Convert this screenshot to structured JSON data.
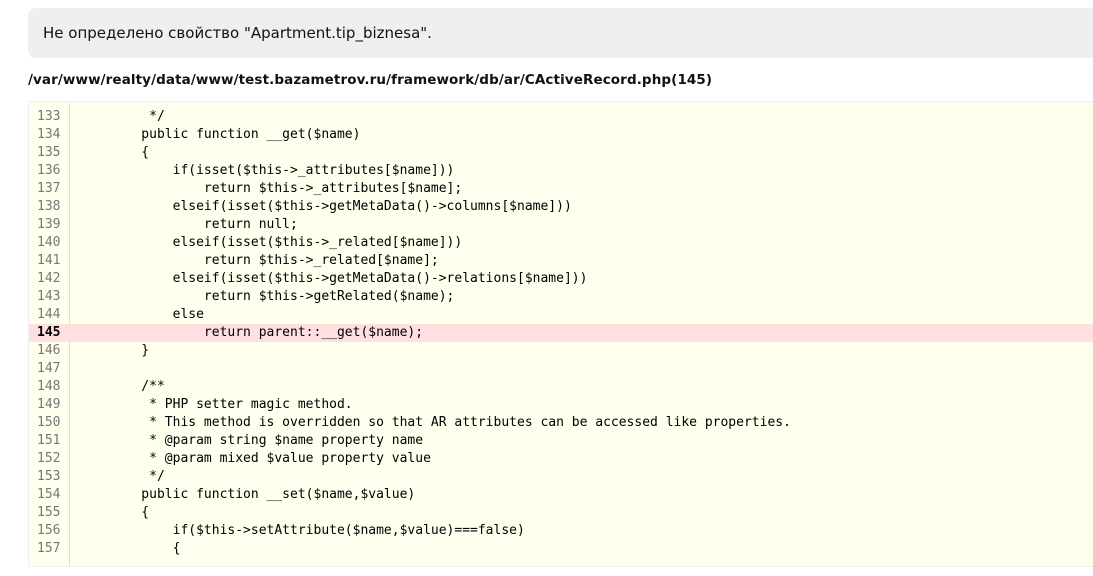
{
  "error": {
    "message": "Не определено свойство \"Apartment.tip_biznesa\"."
  },
  "source": {
    "file_path": "/var/www/realty/data/www/test.bazametrov.ru/framework/db/ar/CActiveRecord.php(145)",
    "lines": [
      {
        "no": "133",
        "code": "     */",
        "error": false
      },
      {
        "no": "134",
        "code": "    public function __get($name)",
        "error": false
      },
      {
        "no": "135",
        "code": "    {",
        "error": false
      },
      {
        "no": "136",
        "code": "        if(isset($this->_attributes[$name]))",
        "error": false
      },
      {
        "no": "137",
        "code": "            return $this->_attributes[$name];",
        "error": false
      },
      {
        "no": "138",
        "code": "        elseif(isset($this->getMetaData()->columns[$name]))",
        "error": false
      },
      {
        "no": "139",
        "code": "            return null;",
        "error": false
      },
      {
        "no": "140",
        "code": "        elseif(isset($this->_related[$name]))",
        "error": false
      },
      {
        "no": "141",
        "code": "            return $this->_related[$name];",
        "error": false
      },
      {
        "no": "142",
        "code": "        elseif(isset($this->getMetaData()->relations[$name]))",
        "error": false
      },
      {
        "no": "143",
        "code": "            return $this->getRelated($name);",
        "error": false
      },
      {
        "no": "144",
        "code": "        else",
        "error": false
      },
      {
        "no": "145",
        "code": "            return parent::__get($name);",
        "error": true
      },
      {
        "no": "146",
        "code": "    }",
        "error": false
      },
      {
        "no": "147",
        "code": "",
        "error": false
      },
      {
        "no": "148",
        "code": "    /**",
        "error": false
      },
      {
        "no": "149",
        "code": "     * PHP setter magic method.",
        "error": false
      },
      {
        "no": "150",
        "code": "     * This method is overridden so that AR attributes can be accessed like properties.",
        "error": false
      },
      {
        "no": "151",
        "code": "     * @param string $name property name",
        "error": false
      },
      {
        "no": "152",
        "code": "     * @param mixed $value property value",
        "error": false
      },
      {
        "no": "153",
        "code": "     */",
        "error": false
      },
      {
        "no": "154",
        "code": "    public function __set($name,$value)",
        "error": false
      },
      {
        "no": "155",
        "code": "    {",
        "error": false
      },
      {
        "no": "156",
        "code": "        if($this->setAttribute($name,$value)===false)",
        "error": false
      },
      {
        "no": "157",
        "code": "        {",
        "error": false
      }
    ]
  }
}
